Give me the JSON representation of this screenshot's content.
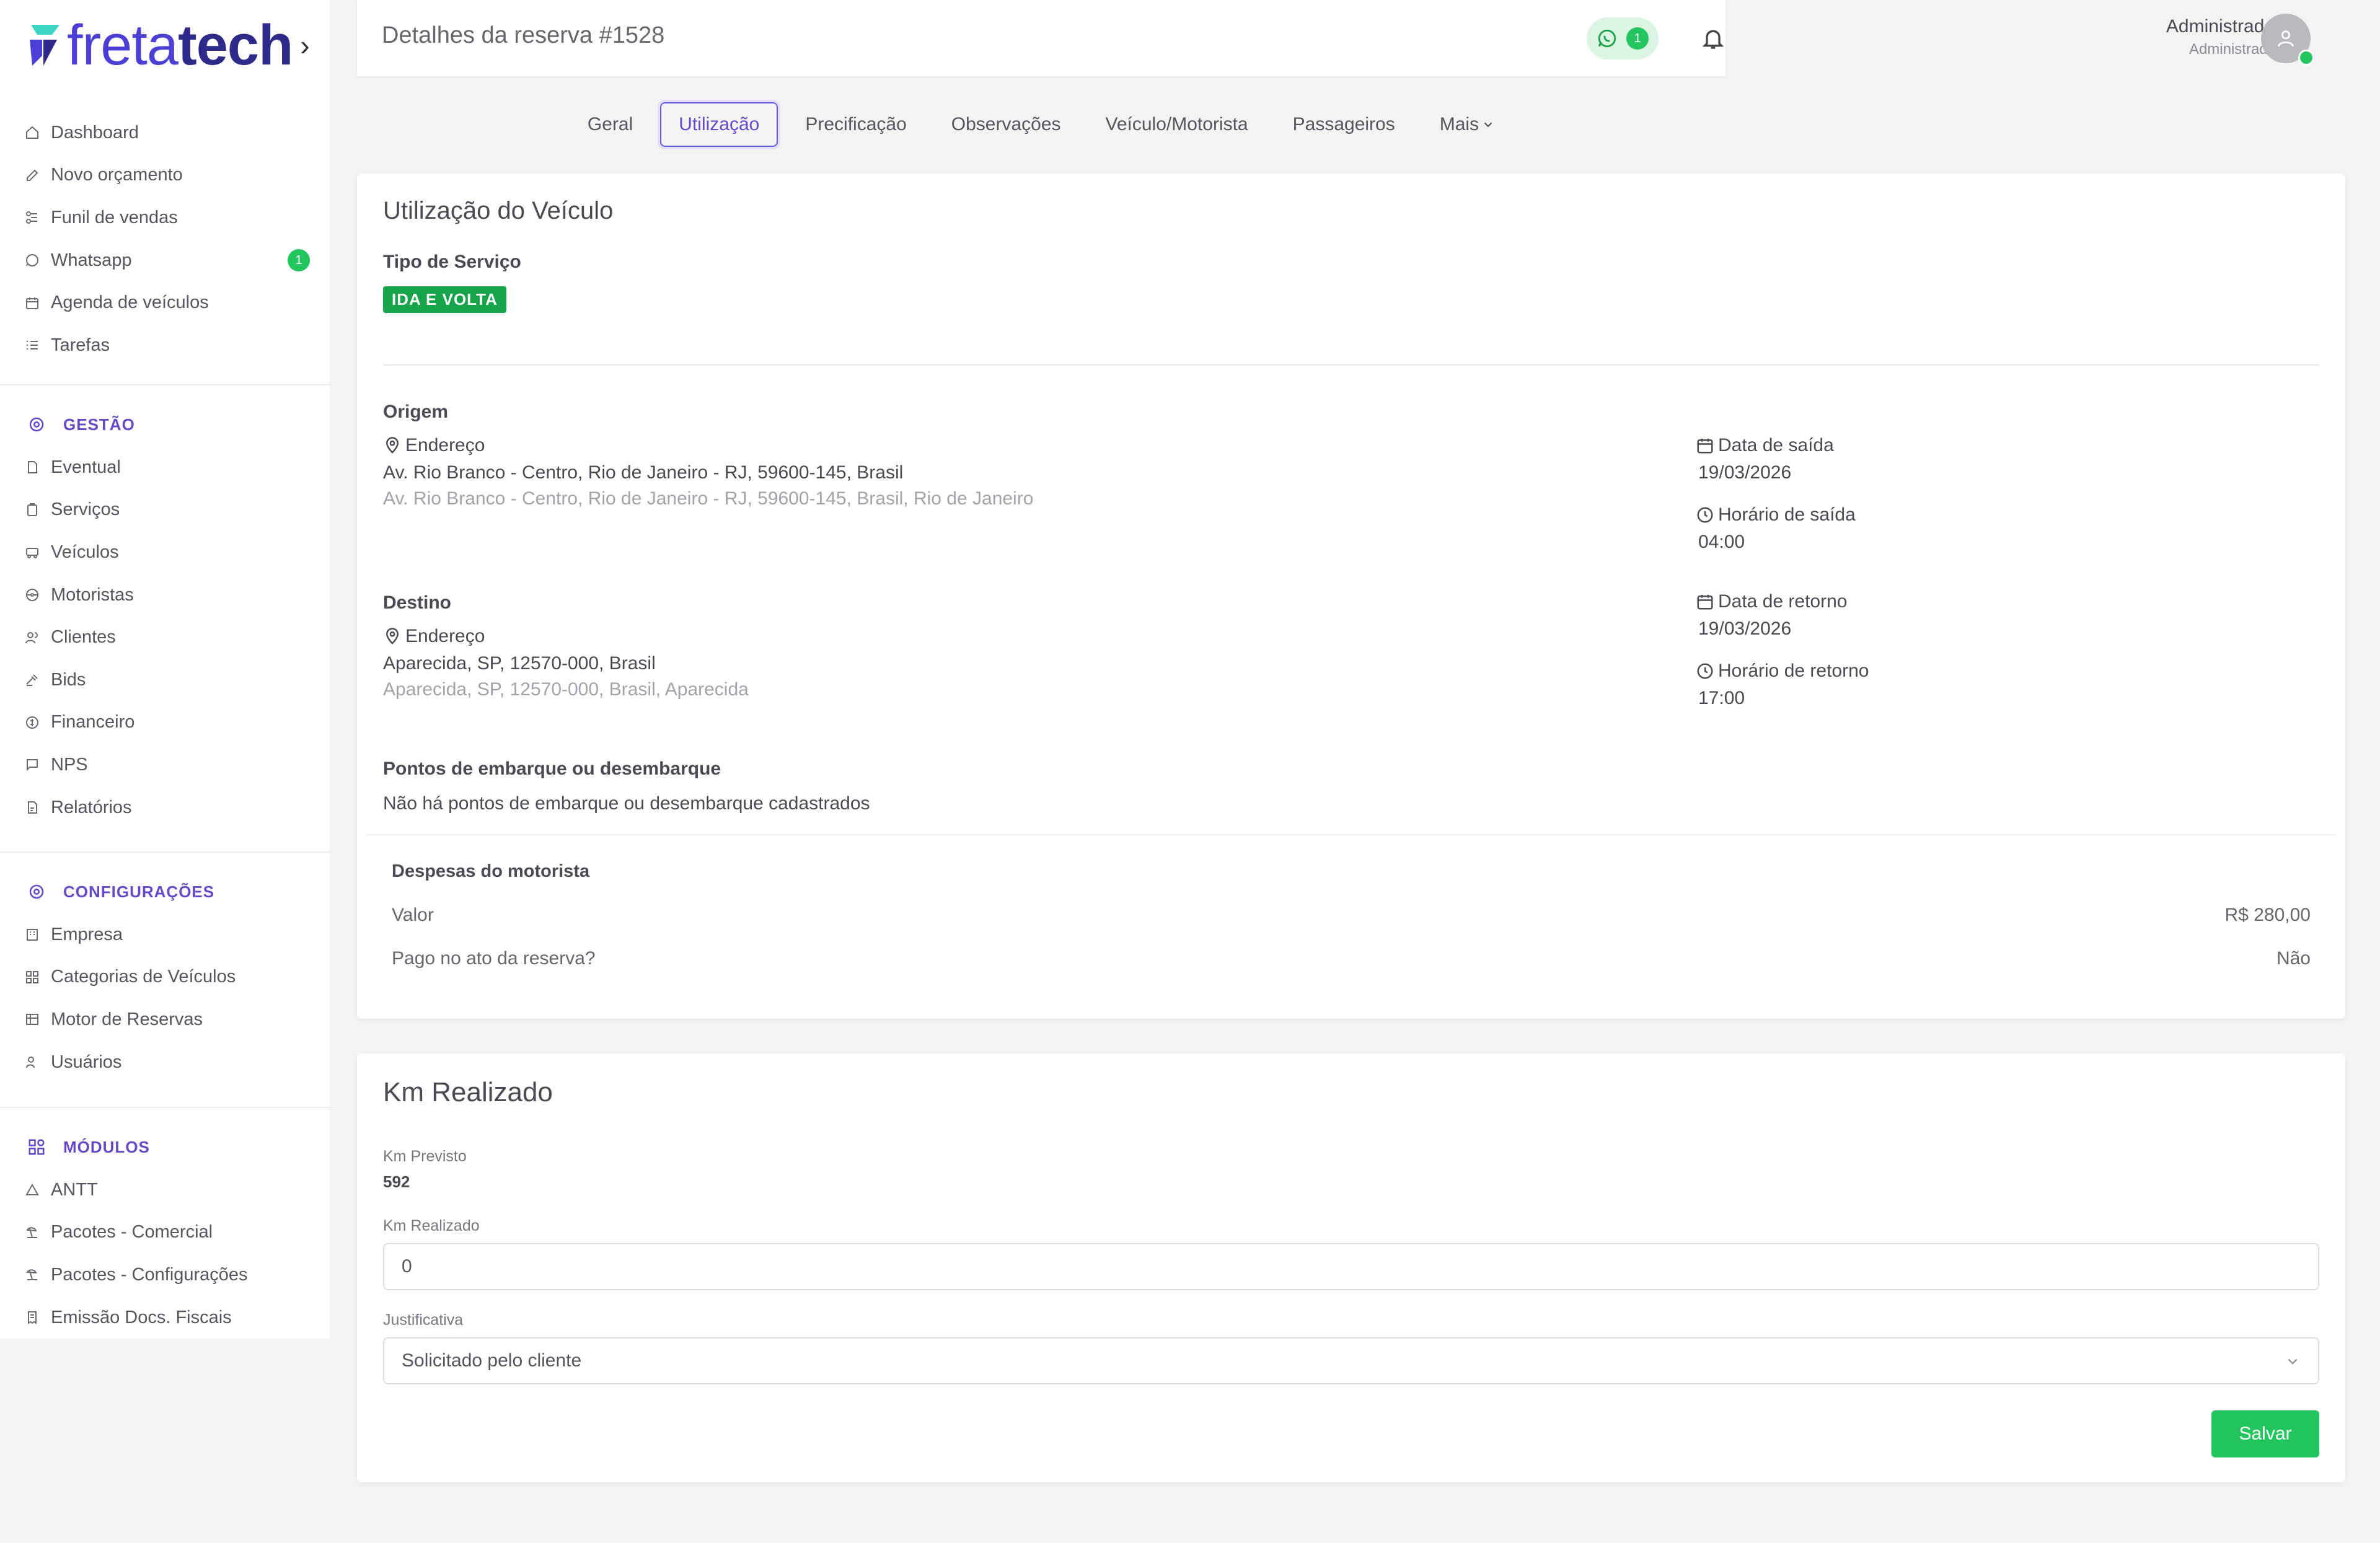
{
  "brand": {
    "name_part1": "freta",
    "name_part2": "tech",
    "colors": {
      "primary": "#4b3fd6",
      "dark": "#2d2a8a",
      "accent": "#22c55e"
    }
  },
  "sidebar": {
    "main_items": [
      {
        "label": "Dashboard",
        "icon": "home-icon"
      },
      {
        "label": "Novo orçamento",
        "icon": "edit-icon"
      },
      {
        "label": "Funil de vendas",
        "icon": "funnel-icon"
      },
      {
        "label": "Whatsapp",
        "icon": "whatsapp-icon",
        "badge": "1"
      },
      {
        "label": "Agenda de veículos",
        "icon": "calendar-icon"
      },
      {
        "label": "Tarefas",
        "icon": "list-icon"
      }
    ],
    "gestao": {
      "title": "GESTÃO",
      "items": [
        {
          "label": "Eventual"
        },
        {
          "label": "Serviços"
        },
        {
          "label": "Veículos"
        },
        {
          "label": "Motoristas"
        },
        {
          "label": "Clientes"
        },
        {
          "label": "Bids"
        },
        {
          "label": "Financeiro"
        },
        {
          "label": "NPS"
        },
        {
          "label": "Relatórios"
        }
      ]
    },
    "configuracoes": {
      "title": "CONFIGURAÇÕES",
      "items": [
        {
          "label": "Empresa"
        },
        {
          "label": "Categorias de Veículos"
        },
        {
          "label": "Motor de Reservas"
        },
        {
          "label": "Usuários"
        }
      ]
    },
    "modulos": {
      "title": "MÓDULOS",
      "items": [
        {
          "label": "ANTT"
        },
        {
          "label": "Pacotes - Comercial"
        },
        {
          "label": "Pacotes - Configurações"
        },
        {
          "label": "Emissão Docs. Fiscais"
        }
      ]
    }
  },
  "header": {
    "title": "Detalhes da reserva #1528",
    "whatsapp_count": "1",
    "user_name": "Administrador",
    "user_role": "Administrador"
  },
  "tabs": {
    "geral": "Geral",
    "utilizacao": "Utilização",
    "precificacao": "Precificação",
    "observacoes": "Observações",
    "veiculo": "Veículo/Motorista",
    "passageiros": "Passageiros",
    "mais": "Mais"
  },
  "utilizacao": {
    "title": "Utilização do Veículo",
    "tipo_label": "Tipo de Serviço",
    "tipo_value": "IDA E VOLTA",
    "origem": {
      "title": "Origem",
      "endereco_label": "Endereço",
      "endereco": "Av. Rio Branco - Centro, Rio de Janeiro - RJ, 59600-145, Brasil",
      "endereco_full": "Av. Rio Branco - Centro, Rio de Janeiro - RJ, 59600-145, Brasil, Rio de Janeiro",
      "data_label": "Data de saída",
      "data": "19/03/2026",
      "hora_label": "Horário de saída",
      "hora": "04:00"
    },
    "destino": {
      "title": "Destino",
      "endereco_label": "Endereço",
      "endereco": "Aparecida, SP, 12570-000, Brasil",
      "endereco_full": "Aparecida, SP, 12570-000, Brasil, Aparecida",
      "data_label": "Data de retorno",
      "data": "19/03/2026",
      "hora_label": "Horário de retorno",
      "hora": "17:00"
    },
    "pontos_title": "Pontos de embarque ou desembarque",
    "pontos_empty": "Não há pontos de embarque ou desembarque cadastrados",
    "despesas": {
      "title": "Despesas do motorista",
      "valor_label": "Valor",
      "valor": "R$ 280,00",
      "pago_label": "Pago no ato da reserva?",
      "pago": "Não"
    }
  },
  "km": {
    "title": "Km Realizado",
    "previsto_label": "Km Previsto",
    "previsto": "592",
    "realizado_label": "Km Realizado",
    "realizado_value": "0",
    "justificativa_label": "Justificativa",
    "justificativa_value": "Solicitado pelo cliente",
    "save": "Salvar"
  }
}
